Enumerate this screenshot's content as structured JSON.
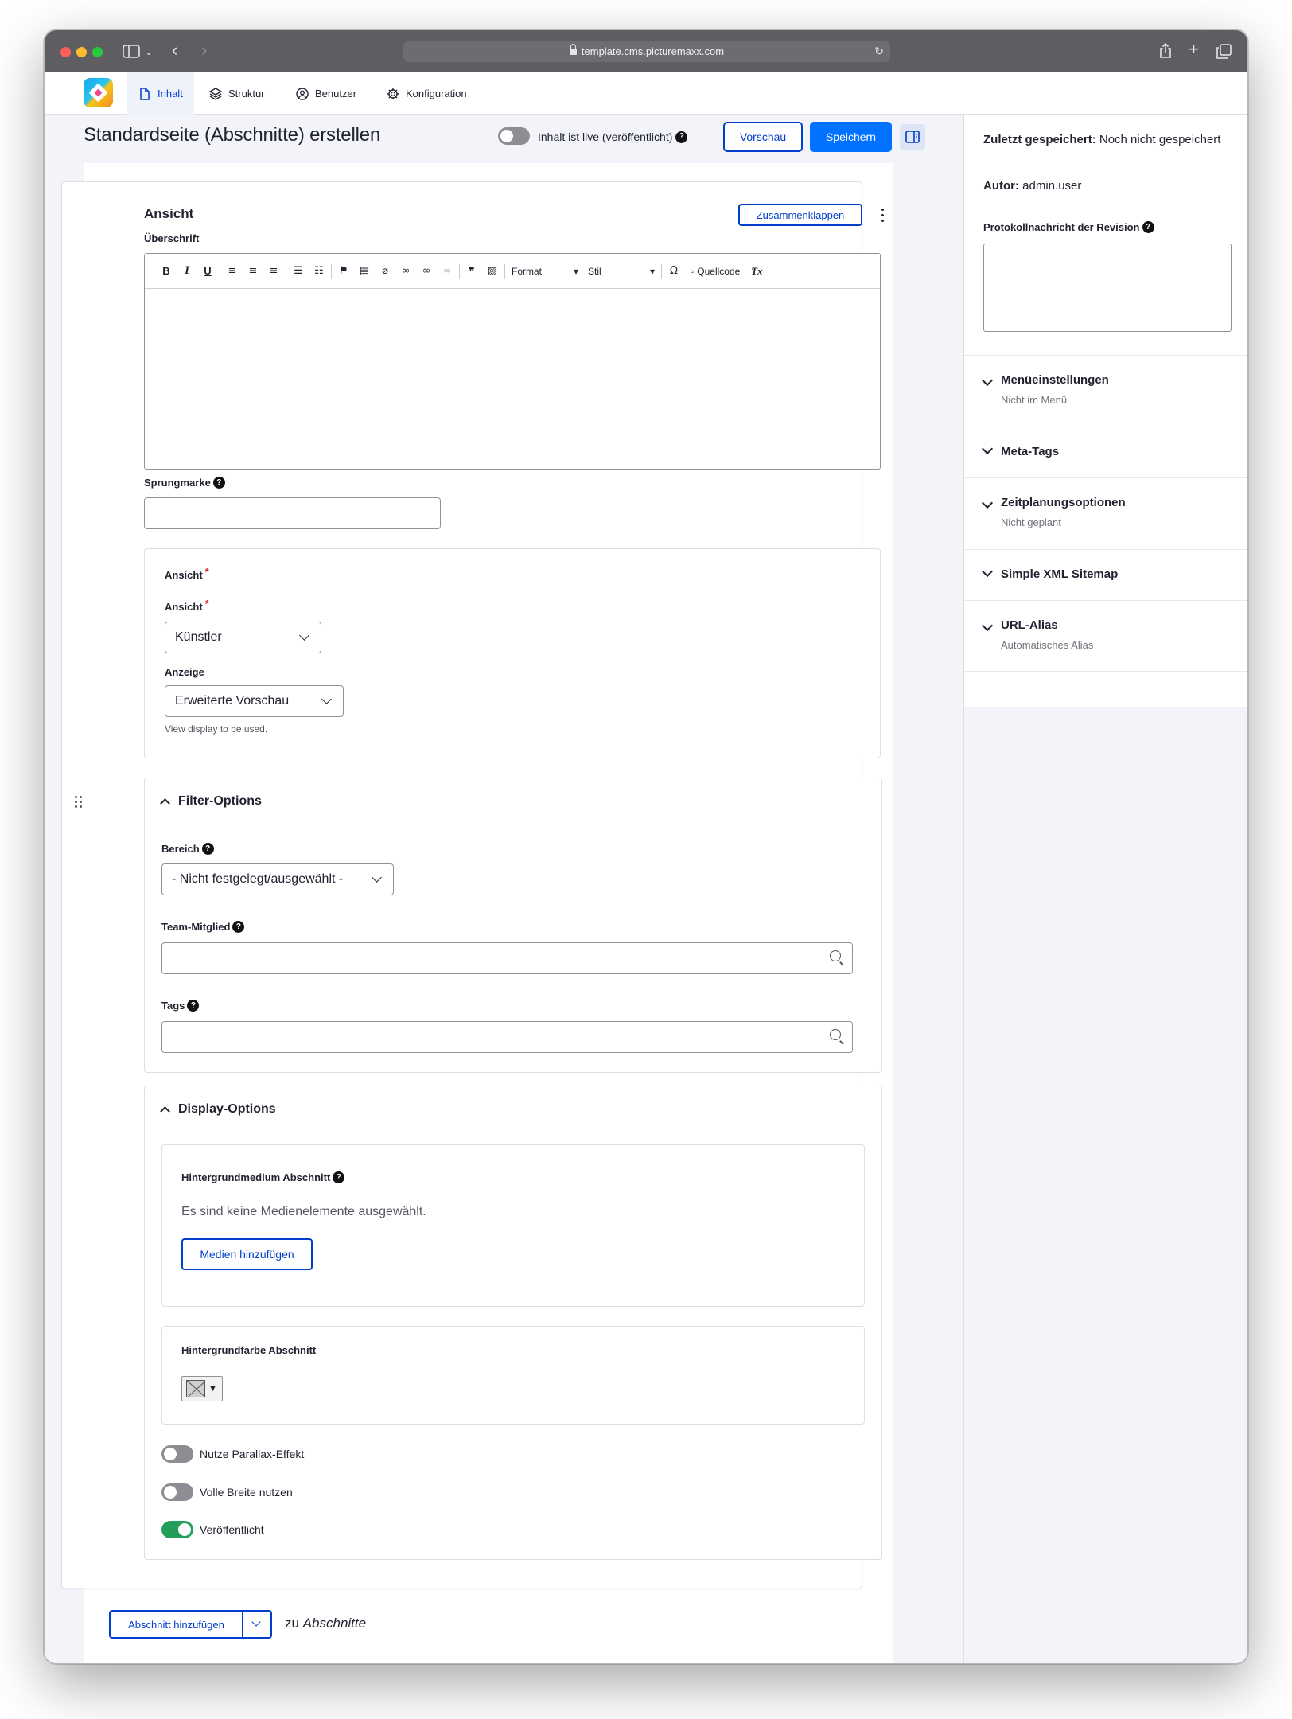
{
  "browser": {
    "url": "template.cms.picturemaxx.com"
  },
  "nav": {
    "tabs": [
      {
        "label": "Inhalt",
        "icon": "file-icon",
        "active": true
      },
      {
        "label": "Struktur",
        "icon": "layers-icon",
        "active": false
      },
      {
        "label": "Benutzer",
        "icon": "user-icon",
        "active": false
      },
      {
        "label": "Konfiguration",
        "icon": "gear-icon",
        "active": false
      }
    ]
  },
  "header": {
    "title": "Standardseite (Abschnitte) erstellen",
    "live_toggle_label": "Inhalt ist live (veröffentlicht)",
    "live_toggle_on": false,
    "preview_label": "Vorschau",
    "save_label": "Speichern"
  },
  "paragraph": {
    "title": "Ansicht",
    "collapse_label": "Zusammenklappen",
    "heading_label": "Überschrift",
    "editor_toolbar": {
      "format_label": "Format",
      "style_label": "Stil",
      "source_label": "Quellcode"
    },
    "anchor_label": "Sprungmarke",
    "anchor_value": "",
    "view_group": {
      "title": "Ansicht",
      "view_label": "Ansicht",
      "view_value": "Künstler",
      "display_label": "Anzeige",
      "display_value": "Erweiterte Vorschau",
      "display_description": "View display to be used."
    },
    "filter_options": {
      "title": "Filter-Options",
      "area_label": "Bereich",
      "area_value": "- Nicht festgelegt/ausgewählt -",
      "team_label": "Team-Mitglied",
      "team_value": "",
      "tags_label": "Tags",
      "tags_value": ""
    },
    "display_options": {
      "title": "Display-Options",
      "bg_media_label": "Hintergrundmedium Abschnitt",
      "bg_media_empty": "Es sind keine Medienelemente ausgewählt.",
      "add_media_label": "Medien hinzufügen",
      "bg_color_label": "Hintergrundfarbe Abschnitt",
      "toggles": [
        {
          "label": "Nutze Parallax-Effekt",
          "on": false
        },
        {
          "label": "Volle Breite nutzen",
          "on": false
        },
        {
          "label": "Veröffentlicht",
          "on": true
        }
      ]
    }
  },
  "add_section": {
    "button_label": "Abschnitt hinzufügen",
    "suffix_prefix": "zu",
    "suffix_target": "Abschnitte"
  },
  "meta": {
    "last_saved_label": "Zuletzt gespeichert:",
    "last_saved_value": "Noch nicht gespeichert",
    "author_label": "Autor:",
    "author_value": "admin.user",
    "revision_label": "Protokollnachricht der Revision",
    "revision_value": "",
    "accordions": [
      {
        "title": "Menüeinstellungen",
        "subtitle": "Nicht im Menü"
      },
      {
        "title": "Meta-Tags",
        "subtitle": ""
      },
      {
        "title": "Zeitplanungsoptionen",
        "subtitle": "Nicht geplant"
      },
      {
        "title": "Simple XML Sitemap",
        "subtitle": ""
      },
      {
        "title": "URL-Alias",
        "subtitle": "Automatisches Alias"
      }
    ]
  },
  "colors": {
    "accent": "#003ecc",
    "primary_button": "#0072ff",
    "toggle_on": "#229e59",
    "toggle_off": "#8d8d93",
    "chrome": "#5e5e62"
  }
}
